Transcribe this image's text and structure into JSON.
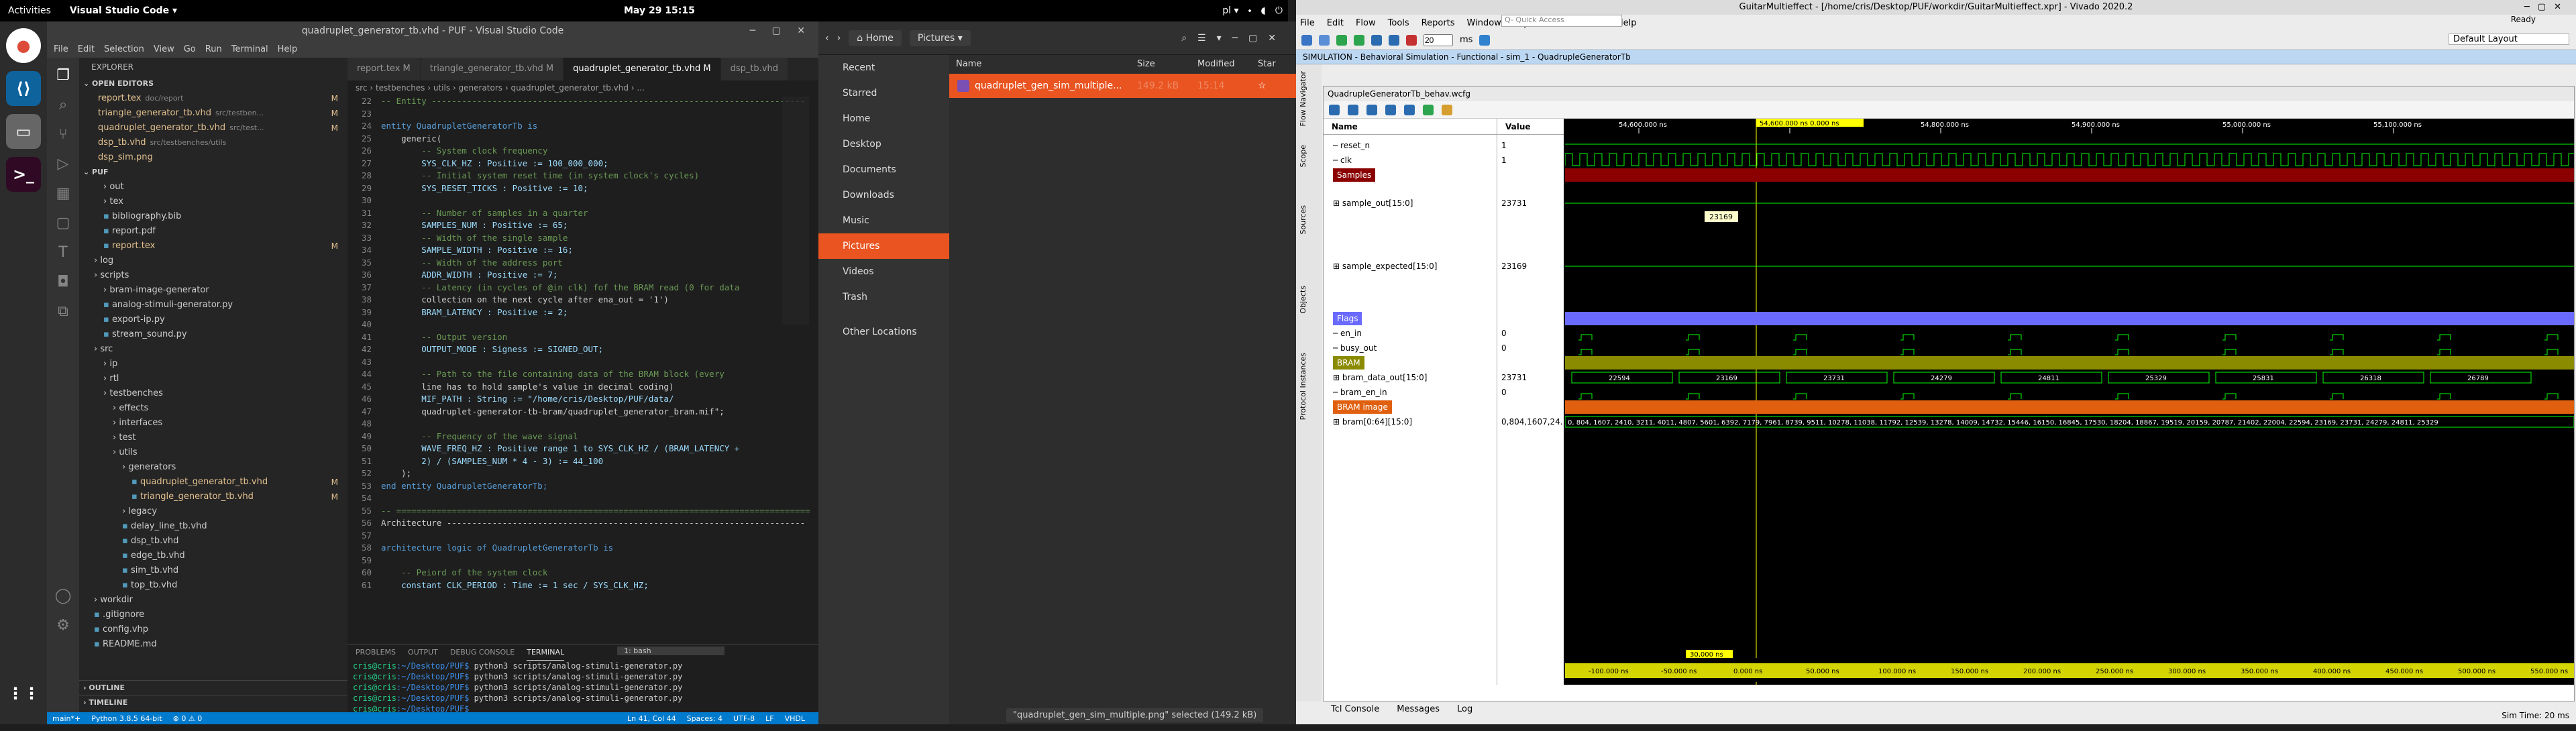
{
  "topbar": {
    "activities": "Activities",
    "app": "Visual Studio Code ▾",
    "clock": "May 29  15:15",
    "lang": "pl ▾"
  },
  "vscode": {
    "title": "quadruplet_generator_tb.vhd - PUF - Visual Studio Code",
    "menu": [
      "File",
      "Edit",
      "Selection",
      "View",
      "Go",
      "Run",
      "Terminal",
      "Help"
    ],
    "explorer": "EXPLORER",
    "open_editors": "OPEN EDITORS",
    "open_files": [
      {
        "name": "report.tex",
        "extra": "doc/report",
        "m": "M"
      },
      {
        "name": "triangle_generator_tb.vhd",
        "extra": "src/testben...",
        "m": "M"
      },
      {
        "name": "quadruplet_generator_tb.vhd",
        "extra": "src/test...",
        "m": "M"
      },
      {
        "name": "dsp_tb.vhd",
        "extra": "src/testbenches/utils",
        "m": ""
      },
      {
        "name": "dsp_sim.png",
        "extra": "",
        "m": ""
      }
    ],
    "root": "PUF",
    "tree": [
      {
        "d": 2,
        "t": "out"
      },
      {
        "d": 2,
        "t": "tex"
      },
      {
        "d": 2,
        "t": "bibliography.bib"
      },
      {
        "d": 2,
        "t": "report.pdf"
      },
      {
        "d": 2,
        "t": "report.tex",
        "m": "M"
      },
      {
        "d": 1,
        "t": "log"
      },
      {
        "d": 1,
        "t": "scripts"
      },
      {
        "d": 2,
        "t": "bram-image-generator"
      },
      {
        "d": 2,
        "t": "analog-stimuli-generator.py"
      },
      {
        "d": 2,
        "t": "export-ip.py"
      },
      {
        "d": 2,
        "t": "stream_sound.py"
      },
      {
        "d": 1,
        "t": "src"
      },
      {
        "d": 2,
        "t": "ip"
      },
      {
        "d": 2,
        "t": "rtl"
      },
      {
        "d": 2,
        "t": "testbenches"
      },
      {
        "d": 3,
        "t": "effects"
      },
      {
        "d": 3,
        "t": "interfaces"
      },
      {
        "d": 3,
        "t": "test"
      },
      {
        "d": 3,
        "t": "utils"
      },
      {
        "d": 4,
        "t": "generators"
      },
      {
        "d": 5,
        "t": "quadruplet_generator_tb.vhd",
        "m": "M"
      },
      {
        "d": 5,
        "t": "triangle_generator_tb.vhd",
        "m": "M"
      },
      {
        "d": 4,
        "t": "legacy"
      },
      {
        "d": 4,
        "t": "delay_line_tb.vhd"
      },
      {
        "d": 4,
        "t": "dsp_tb.vhd"
      },
      {
        "d": 4,
        "t": "edge_tb.vhd"
      },
      {
        "d": 4,
        "t": "sim_tb.vhd"
      },
      {
        "d": 4,
        "t": "top_tb.vhd"
      },
      {
        "d": 1,
        "t": "workdir"
      },
      {
        "d": 1,
        "t": ".gitignore"
      },
      {
        "d": 1,
        "t": "config.vhp"
      },
      {
        "d": 1,
        "t": "README.md"
      }
    ],
    "outline": "OUTLINE",
    "timeline": "TIMELINE",
    "tabs": [
      "report.tex M",
      "triangle_generator_tb.vhd M",
      "quadruplet_generator_tb.vhd M",
      "dsp_tb.vhd"
    ],
    "breadcrumb": "src › testbenches › utils › generators › quadruplet_generator_tb.vhd › ...",
    "code_start": 22,
    "code": [
      "-- Entity --------------------------------------------------------------------------",
      "",
      "entity QuadrupletGeneratorTb is",
      "    generic(",
      "        -- System clock frequency",
      "        SYS_CLK_HZ : Positive := 100_000_000;",
      "        -- Initial system reset time (in system clock's cycles)",
      "        SYS_RESET_TICKS : Positive := 10;",
      "",
      "        -- Number of samples in a quarter",
      "        SAMPLES_NUM : Positive := 65;",
      "        -- Width of the single sample",
      "        SAMPLE_WIDTH : Positive := 16;",
      "        -- Width of the address port",
      "        ADDR_WIDTH : Positive := 7;",
      "        -- Latency (in cycles of @in clk) fof the BRAM read (0 for data",
      "        collection on the next cycle after ena_out = '1')",
      "        BRAM_LATENCY : Positive := 2;",
      "",
      "        -- Output version",
      "        OUTPUT_MODE : Signess := SIGNED_OUT;",
      "",
      "        -- Path to the file containing data of the BRAM block (every",
      "        line has to hold sample's value in decimal coding)",
      "        MIF_PATH : String := \"/home/cris/Desktop/PUF/data/",
      "        quadruplet-generator-tb-bram/quadruplet_generator_bram.mif\";",
      "",
      "        -- Frequency of the wave signal",
      "        WAVE_FREQ_HZ : Positive range 1 to SYS_CLK_HZ / (BRAM_LATENCY +",
      "        2) / (SAMPLES_NUM * 4 - 3) := 44_100",
      "    );",
      "end entity QuadrupletGeneratorTb;",
      "",
      "-- ==================================================================================",
      "Architecture -----------------------------------------------------------------------",
      "",
      "architecture logic of QuadrupletGeneratorTb is",
      "",
      "    -- Peiord of the system clock",
      "    constant CLK_PERIOD : Time := 1 sec / SYS_CLK_HZ;"
    ],
    "panel_tabs": [
      "PROBLEMS",
      "OUTPUT",
      "DEBUG CONSOLE",
      "TERMINAL"
    ],
    "panel_select": "1: bash",
    "terminal": [
      {
        "p": "cris@cris",
        "d": ":~/Desktop/PUF$",
        "c": " python3 scripts/analog-stimuli-generator.py"
      },
      {
        "p": "cris@cris",
        "d": ":~/Desktop/PUF$",
        "c": " python3 scripts/analog-stimuli-generator.py"
      },
      {
        "p": "cris@cris",
        "d": ":~/Desktop/PUF$",
        "c": " python3 scripts/analog-stimuli-generator.py"
      },
      {
        "p": "cris@cris",
        "d": ":~/Desktop/PUF$",
        "c": " python3 scripts/analog-stimuli-generator.py"
      },
      {
        "p": "cris@cris",
        "d": ":~/Desktop/PUF$",
        "c": " "
      }
    ],
    "status": {
      "branch": "main*+",
      "python": "Python 3.8.5 64-bit",
      "problems": "⊗ 0 ⚠ 0",
      "pos": "Ln 41, Col 44",
      "spaces": "Spaces: 4",
      "enc": "UTF-8",
      "eol": "LF",
      "lang": "VHDL"
    }
  },
  "files": {
    "home": "Home",
    "pictures": "Pictures",
    "places": [
      "Recent",
      "Starred",
      "Home",
      "Desktop",
      "Documents",
      "Downloads",
      "Music",
      "Pictures",
      "Videos",
      "Trash",
      "Other Locations"
    ],
    "cols": {
      "name": "Name",
      "size": "Size",
      "modified": "Modified",
      "star": "Star"
    },
    "row": {
      "name": "quadruplet_gen_sim_multiple...",
      "size": "149.2 kB",
      "modified": "15:14"
    },
    "status": "\"quadruplet_gen_sim_multiple.png\" selected  (149.2 kB)"
  },
  "vivado": {
    "title": "GuitarMultieffect - [/home/cris/Desktop/PUF/workdir/GuitarMultieffect.xpr] - Vivado 2020.2",
    "menu": [
      "File",
      "Edit",
      "Flow",
      "Tools",
      "Reports",
      "Window",
      "Layout",
      "View",
      "Run",
      "Help"
    ],
    "quick": "Q- Quick Access",
    "ready": "Ready",
    "time_val": "20",
    "time_unit": "ms",
    "layout": "Default Layout",
    "sim_bar": "SIMULATION - Behavioral Simulation - Functional - sim_1 - QuadrupleGeneratorTb",
    "wave_title": "QuadrupleGeneratorTb_behav.wcfg",
    "side": [
      "Flow Navigator",
      "Scope",
      "Sources",
      "Objects",
      "Protocol Instances"
    ],
    "col_name": "Name",
    "col_value": "Value",
    "cursor": "54,600.000 ns  0.000 ns",
    "ticks": [
      "54,600.000 ns",
      "54,700.000 ns",
      "54,800.000 ns",
      "54,900.000 ns",
      "55,000.000 ns",
      "55,100.000 ns"
    ],
    "signals": [
      {
        "n": "reset_n",
        "v": "1"
      },
      {
        "n": "clk",
        "v": "1"
      },
      {
        "n": "Samples",
        "v": "",
        "grp": true
      },
      {
        "n": "sample_out[15:0]",
        "v": "23731"
      },
      {
        "n": "sample_expected[15:0]",
        "v": "23169"
      },
      {
        "n": "Flags",
        "v": "",
        "grp": true
      },
      {
        "n": "en_in",
        "v": "0"
      },
      {
        "n": "busy_out",
        "v": "0"
      },
      {
        "n": "BRAM",
        "v": "",
        "grp": true
      },
      {
        "n": "bram_data_out[15:0]",
        "v": "23731"
      },
      {
        "n": "bram_en_in",
        "v": "0"
      },
      {
        "n": "BRAM image",
        "v": "",
        "grp": true
      },
      {
        "n": "bram[0:64][15:0]",
        "v": "0,804,1607,24..."
      }
    ],
    "tooltip": "23169",
    "bram_vals": [
      "22594",
      "23169",
      "23731",
      "24279",
      "24811",
      "25329",
      "25831",
      "26318",
      "26789"
    ],
    "bram_image": "0, 804, 1607, 2410, 3211, 4011, 4807, 5601, 6392, 7179, 7961, 8739, 9511, 10278, 11038, 11792, 12539, 13278, 14009, 14732, 15446, 16150, 16845, 17530, 18204, 18867, 19519, 20159, 20787, 21402, 22004, 22594, 23169, 23731, 24279, 24811, 25329",
    "bottom_cursor": "30,000 ns",
    "bottom_ticks": [
      "-100.000 ns",
      "-50.000 ns",
      "0.000 ns",
      "50.000 ns",
      "100.000 ns",
      "150.000 ns",
      "200.000 ns",
      "250.000 ns",
      "300.000 ns",
      "350.000 ns",
      "400.000 ns",
      "450.000 ns",
      "500.000 ns",
      "550.000 ns"
    ],
    "btabs": [
      "Tcl Console",
      "Messages",
      "Log"
    ],
    "sim_time": "Sim Time: 20 ms"
  }
}
